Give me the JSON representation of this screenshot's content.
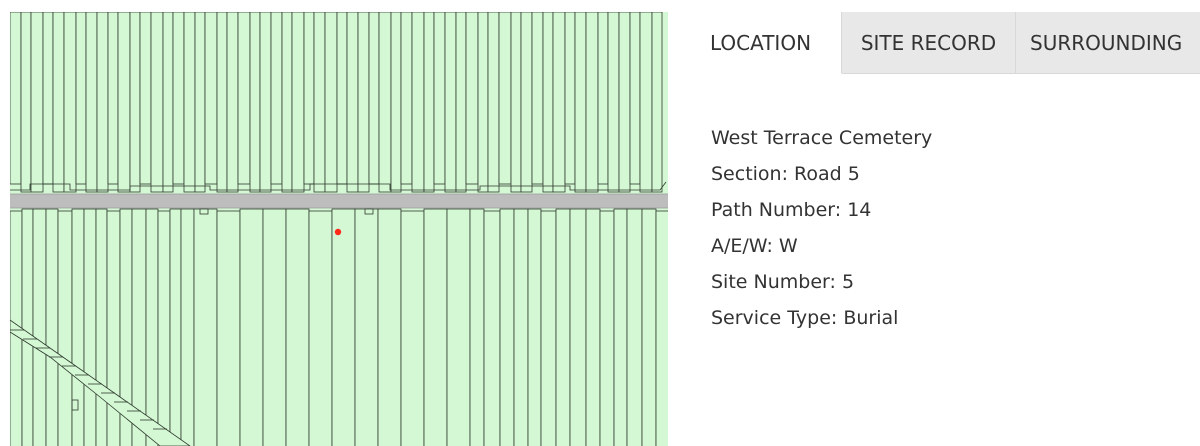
{
  "tabs": [
    {
      "label": "LOCATION",
      "active": true
    },
    {
      "label": "SITE RECORD",
      "active": false
    },
    {
      "label": "SURROUNDING",
      "active": false
    }
  ],
  "location_details": {
    "cemetery": "West Terrace Cemetery",
    "section": "Section: Road 5",
    "path_number": "Path Number: 14",
    "aew": "A/E/W: W",
    "site_number": "Site Number: 5",
    "service_type": "Service Type: Burial"
  },
  "map": {
    "plot_fill_color": "#d4f7d4",
    "plot_stroke_color": "#2e3a2e",
    "road_color": "#bdbdbd",
    "marker_color": "#ff2a1a"
  }
}
